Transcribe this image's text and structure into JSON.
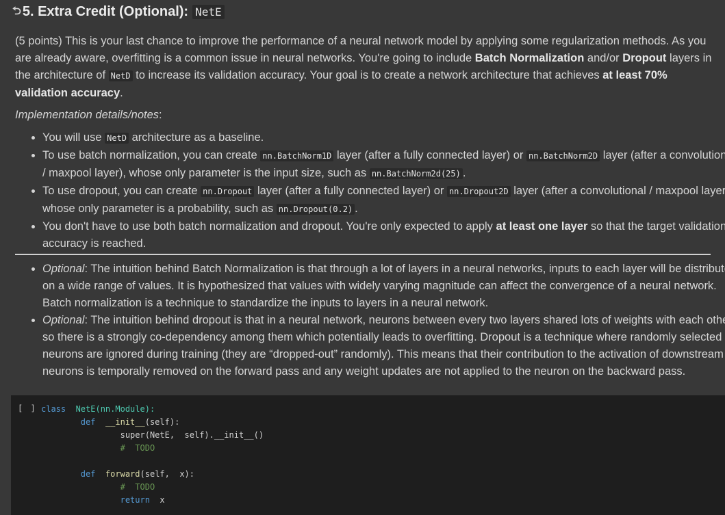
{
  "heading": {
    "number": "5.",
    "title": "Extra Credit (Optional):",
    "code": "NetE"
  },
  "intro": {
    "text1": "(5 points) This is your last chance to improve the performance of a neural network model by applying some regularization methods. As you are already aware, overfitting is a common issue in neural networks. You're going to include ",
    "bold1": "Batch Normalization",
    "text2": " and/or ",
    "bold2": "Dropout",
    "text3": " layers in the architecture of ",
    "code1": "NetD",
    "text4": " to increase its validation accuracy. Your goal is to create a network architecture that achieves ",
    "bold3": "at least 70% validation accuracy",
    "text5": "."
  },
  "impl_label": "Implementation details/notes",
  "impl_colon": ":",
  "list1": [
    {
      "t1": "You will use ",
      "c1": "NetD",
      "t2": " architecture as a baseline."
    },
    {
      "t1": "To use batch normalization, you can create ",
      "c1": "nn.BatchNorm1D",
      "t2": " layer (after a fully connected layer) or ",
      "c2": "nn.BatchNorm2D",
      "t3": " layer (after a convolutional / maxpool layer), whose only parameter is the input size, such as ",
      "c3": "nn.BatchNorm2d(25)",
      "t4": "."
    },
    {
      "t1": "To use dropout, you can create ",
      "c1": "nn.Dropout",
      "t2": " layer (after a fully connected layer) or ",
      "c2": "nn.Dropout2D",
      "t3": " layer (after a convolutional / maxpool layer), whose only parameter is a probability, such as ",
      "c3": "nn.Dropout(0.2)",
      "t4": "."
    },
    {
      "t1": "You don't have to use both batch normalization and dropout. You're only expected to apply ",
      "b1": "at least one layer",
      "t2": " so that the target validation accuracy is reached."
    }
  ],
  "list2": [
    {
      "label": "Optional",
      "text": ": The intuition behind Batch Normalization is that through a lot of layers in a neural networks, inputs to each layer will be distributed on a wide range of values. It is hypothesized that values with widely varying magnitude can affect the convergence of a neural network. Batch normalization is a technique to standardize the inputs to layers in a neural network."
    },
    {
      "label": "Optional",
      "text": ": The intuition behind dropout is that in a neural network, neurons between every two layers shared lots of weights with each other, so there is a strongly co-dependency among them which potentially leads to overfitting. Dropout is a technique where randomly selected neurons are ignored during training (they are “dropped-out” randomly). This means that their contribution to the activation of downstream neurons is temporally removed on the forward pass and any weight updates are not applied to the neuron on the backward pass."
    }
  ],
  "code_cell": {
    "run_label": "[ ]",
    "class_kw": "class",
    "class_name": "NetE",
    "class_base": "(nn.Module):",
    "def_kw": "def",
    "init_name": "__init__",
    "init_args": "(self):",
    "super_call": "super(NetE,  self).__init__()",
    "comment1": "#  TODO",
    "forward_name": "forward",
    "forward_args": "(self,  x):",
    "comment2": "#  TODO",
    "return_kw": "return",
    "return_val": "x"
  },
  "colors": {
    "background": "#383838",
    "code_background": "#1e1e1e",
    "keyword": "#569cd6",
    "comment": "#6a9955",
    "class": "#4ec9b0"
  }
}
